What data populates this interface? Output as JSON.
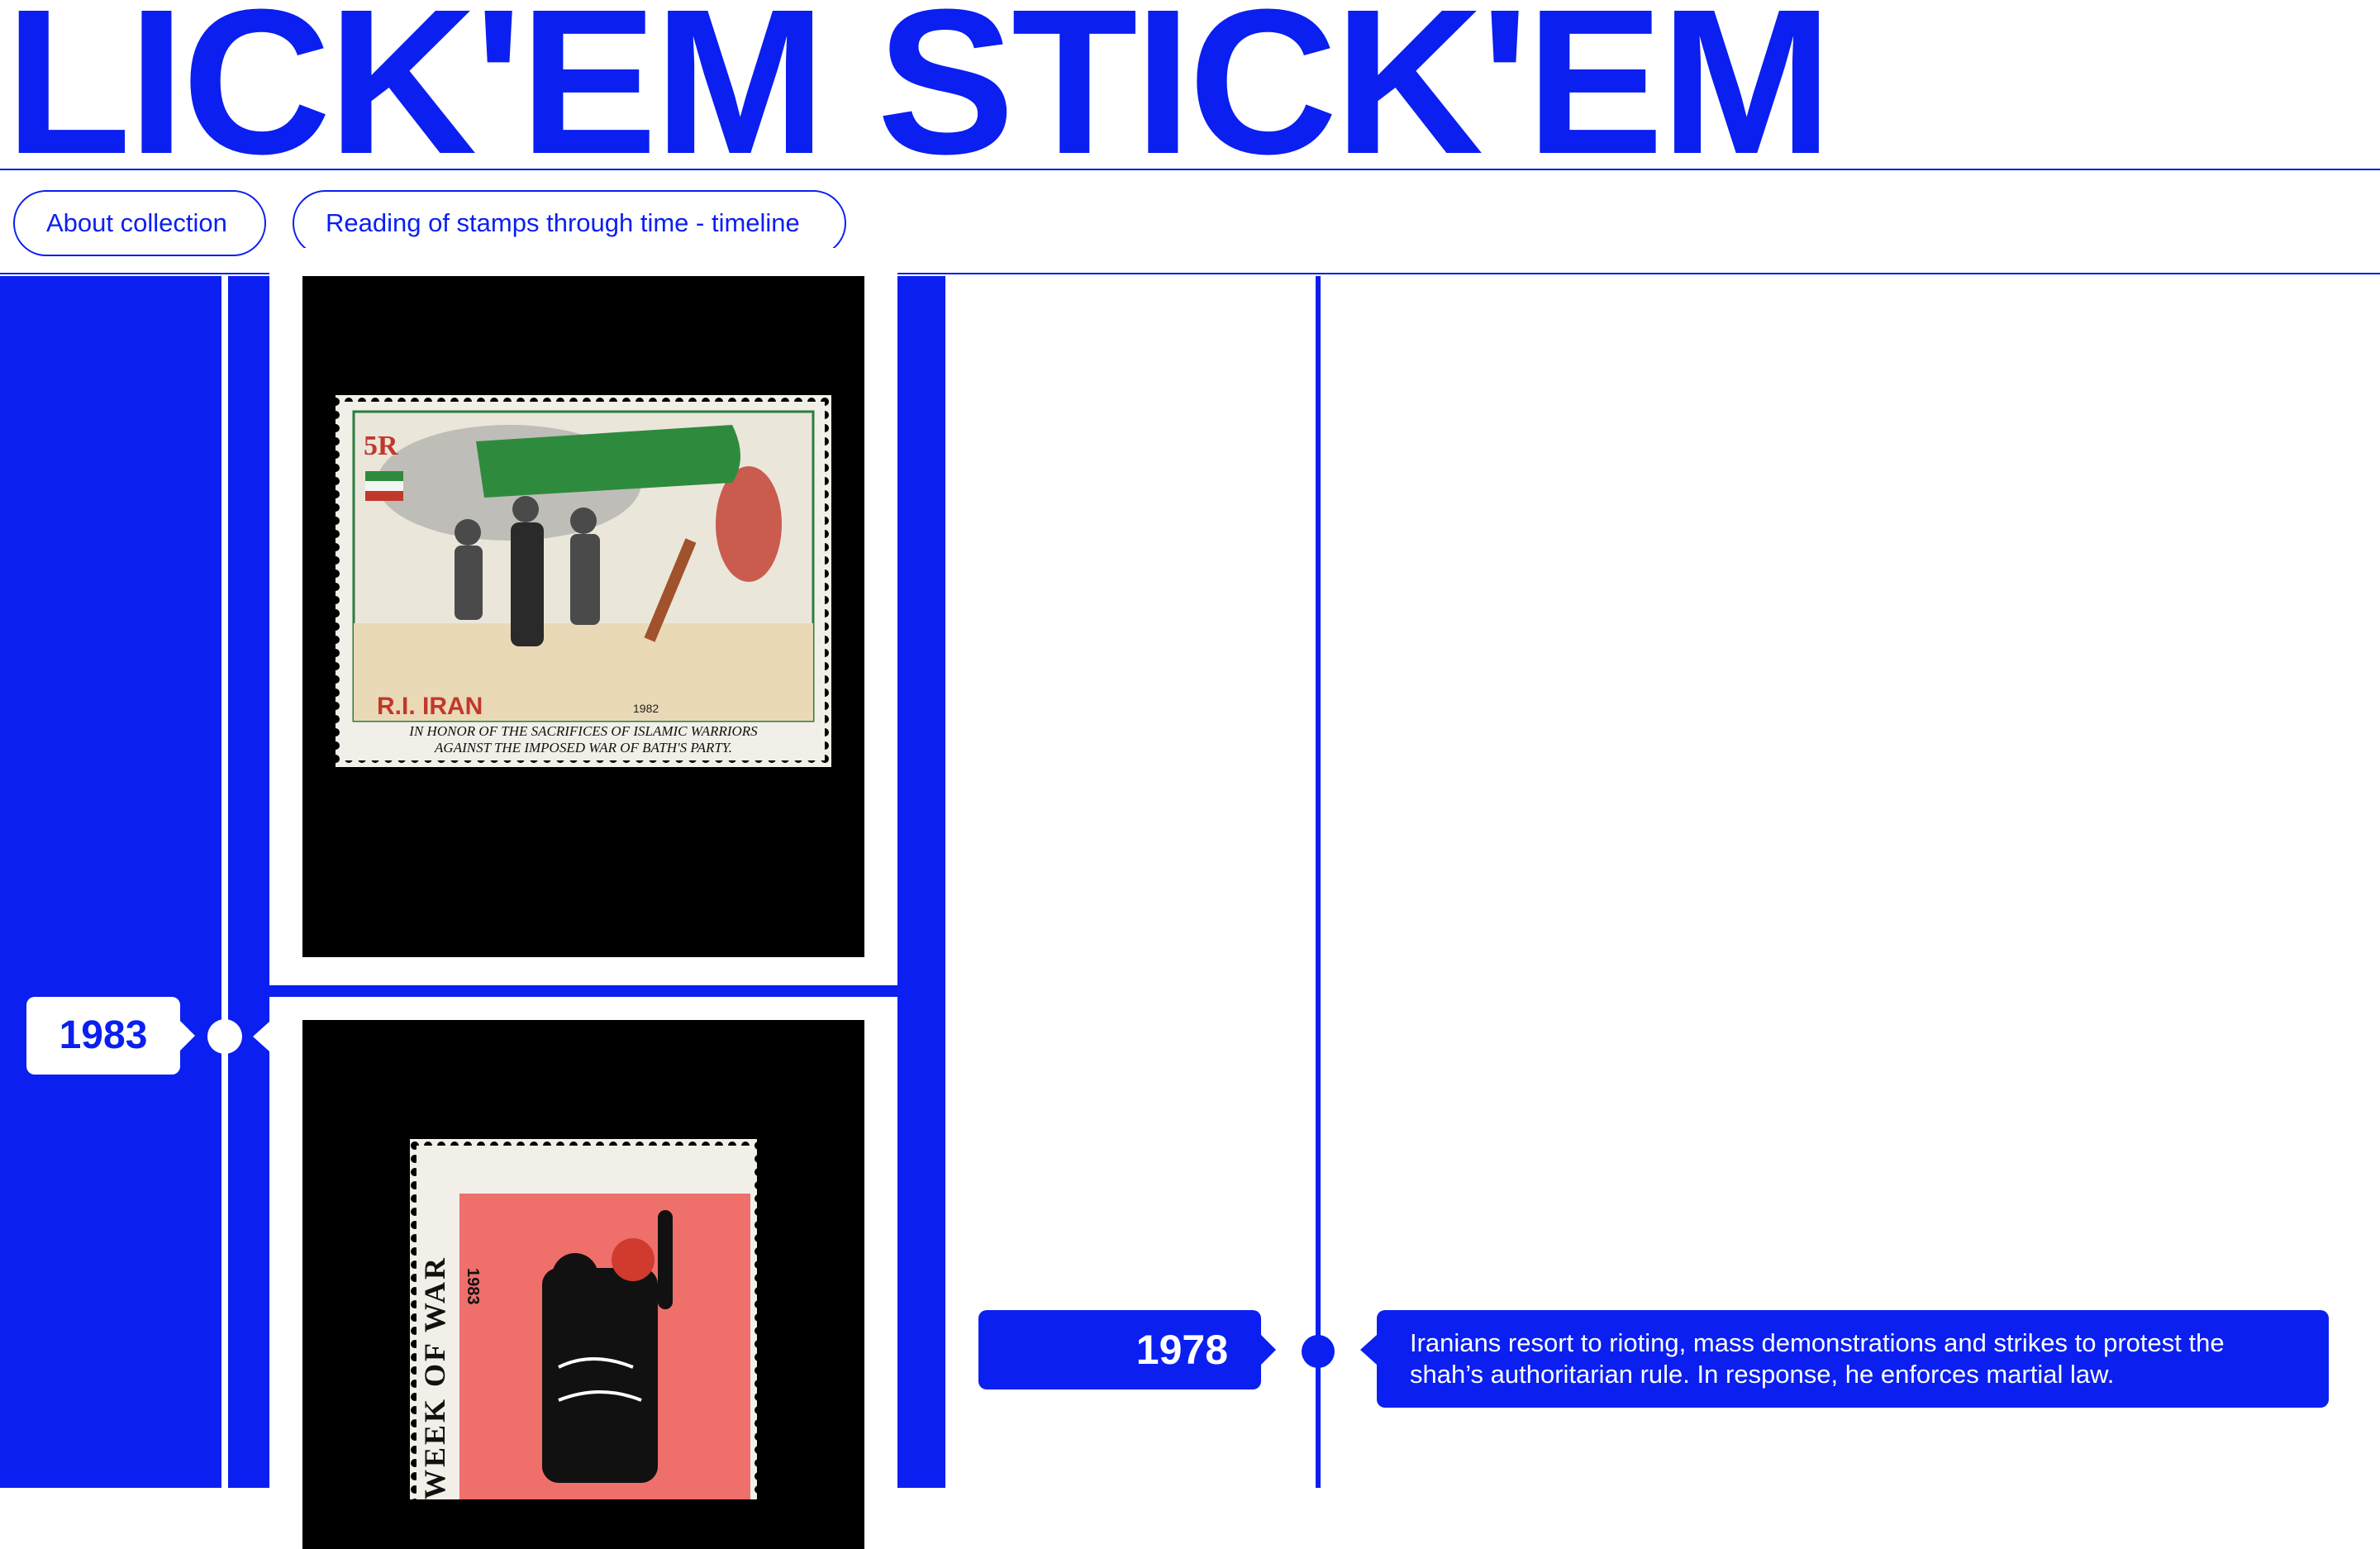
{
  "site": {
    "title": "LICK'EM STICK'EM"
  },
  "nav": {
    "about_label": "About collection",
    "timeline_label": "Reading of stamps through time - timeline"
  },
  "timeline_left": {
    "year": "1983",
    "stamp_1": {
      "denomination": "5R",
      "country": "R.I. IRAN",
      "year_printed": "1982",
      "caption_line_1": "IN HONOR OF THE SACRIFICES OF ISLAMIC WARRIORS",
      "caption_line_2": "AGAINST THE IMPOSED WAR OF BATH'S PARTY."
    },
    "stamp_2": {
      "side_text": "WEEK OF WAR",
      "year_printed": "1983"
    }
  },
  "timeline_right": {
    "year": "1978",
    "event_text": "Iranians resort to rioting, mass demonstrations and strikes to protest the shah’s authoritarian rule. In response, he enforces martial law."
  },
  "colors": {
    "accent": "#0a1ff0",
    "background": "#ffffff",
    "stamp_bg": "#000000"
  }
}
